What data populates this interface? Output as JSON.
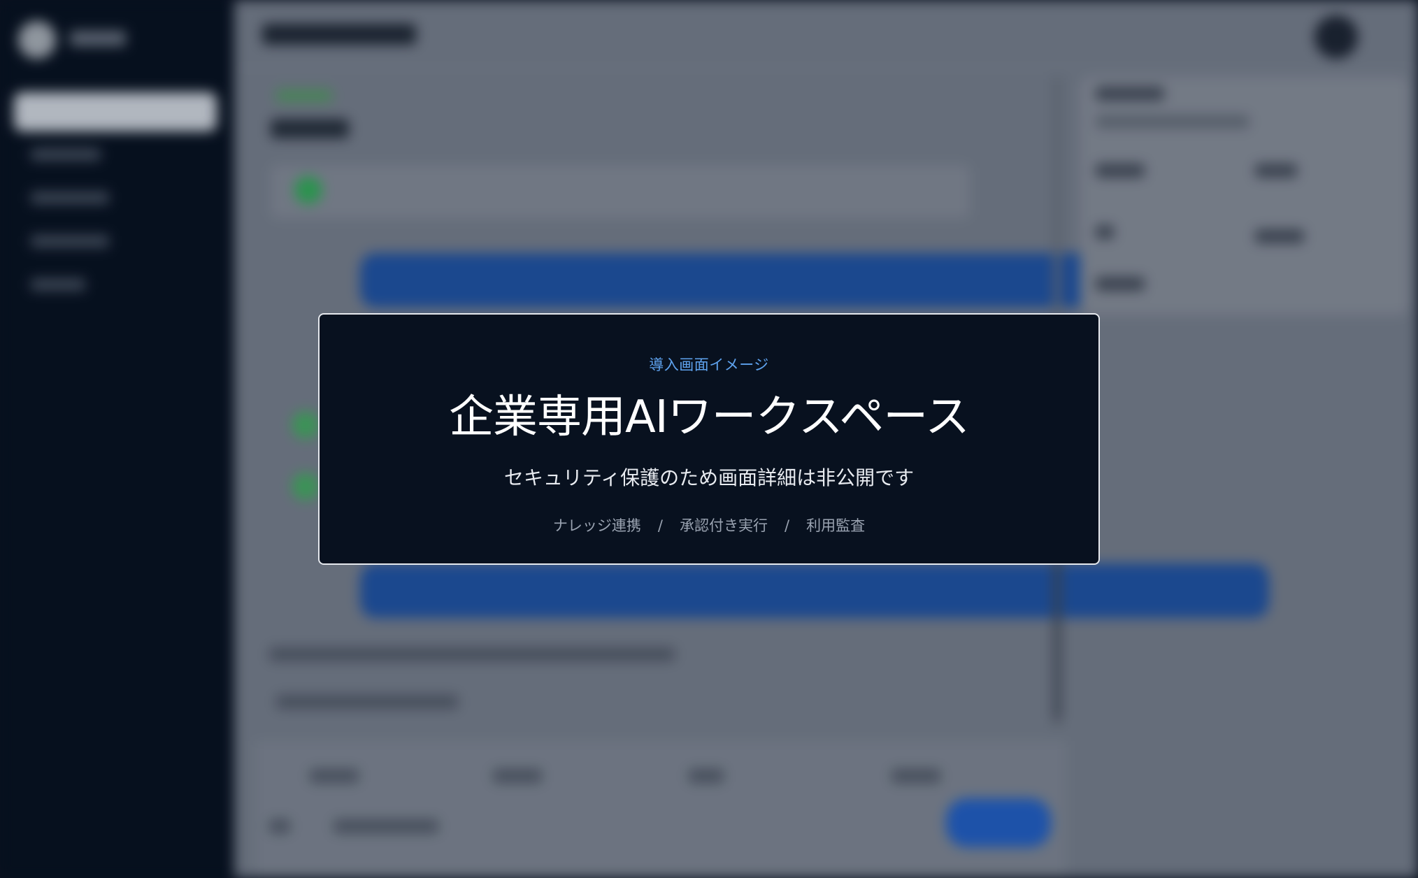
{
  "notice": {
    "eyebrow": "導入画面イメージ",
    "title": "企業専用AIワークスペース",
    "subtitle": "セキュリティ保護のため画面詳細は非公開です",
    "features": [
      "ナレッジ連携",
      "承認付き実行",
      "利用監査"
    ],
    "separator": "/"
  },
  "colors": {
    "sidebar_bg": "#07101f",
    "main_bg": "#6b7280",
    "modal_bg": "#08111f",
    "modal_border": "#e6e9ee",
    "accent_blue": "#5ea2ee",
    "bubble_blue": "#1d4b95",
    "status_green": "#2e9a52"
  }
}
